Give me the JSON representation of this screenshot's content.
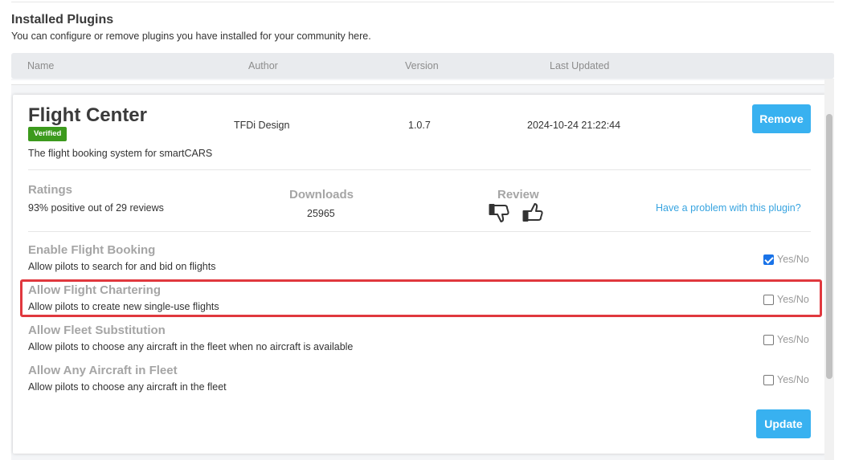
{
  "section": {
    "title": "Installed Plugins",
    "subtitle": "You can configure or remove plugins you have installed for your community here."
  },
  "table": {
    "headers": [
      "Name",
      "Author",
      "Version",
      "Last Updated"
    ]
  },
  "plugin": {
    "name": "Flight Center",
    "badge": "Verified",
    "description": "The flight booking system for smartCARS",
    "author": "TFDi Design",
    "version": "1.0.7",
    "last_updated": "2024-10-24 21:22:44",
    "remove_label": "Remove",
    "update_label": "Update"
  },
  "stats": {
    "ratings_title": "Ratings",
    "ratings_text": "93% positive out of 29 reviews",
    "downloads_title": "Downloads",
    "downloads_value": "25965",
    "review_title": "Review",
    "problem_link": "Have a problem with this plugin?"
  },
  "settings": [
    {
      "title": "Enable Flight Booking",
      "desc": "Allow pilots to search for and bid on flights",
      "checked": true,
      "toggle": "Yes/No"
    },
    {
      "title": "Allow Flight Chartering",
      "desc": "Allow pilots to create new single-use flights",
      "checked": false,
      "toggle": "Yes/No"
    },
    {
      "title": "Allow Fleet Substitution",
      "desc": "Allow pilots to choose any aircraft in the fleet when no aircraft is available",
      "checked": false,
      "toggle": "Yes/No"
    },
    {
      "title": "Allow Any Aircraft in Fleet",
      "desc": "Allow pilots to choose any aircraft in the fleet",
      "checked": false,
      "toggle": "Yes/No"
    }
  ],
  "colors": {
    "accent": "#38b1f0",
    "verified": "#3c9a1d",
    "highlight": "#e0383e",
    "link": "#38a4e0"
  },
  "icons": {
    "thumbs_down": "thumbs-down-icon",
    "thumbs_up": "thumbs-up-icon"
  }
}
